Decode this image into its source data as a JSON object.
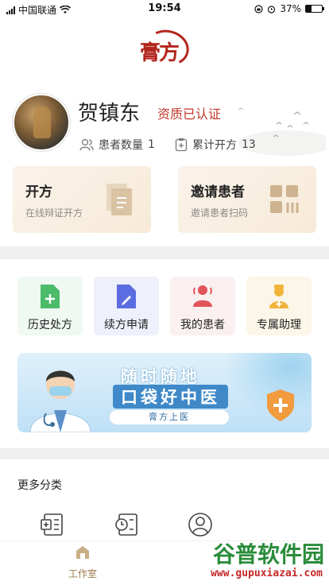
{
  "status_bar": {
    "carrier": "中国联通",
    "time": "19:54",
    "battery": "37%",
    "battery_level": 0.37,
    "icons": [
      "signal-icon",
      "wifi-icon",
      "lock-rotation-icon",
      "alarm-icon",
      "battery-icon"
    ]
  },
  "brand": {
    "logo_text": "膏方",
    "color": "#b3261e"
  },
  "profile": {
    "name": "贺镇东",
    "certification": "资质已认证",
    "patients_label": "患者数量",
    "patients_value": "1",
    "rx_label": "累计开方",
    "rx_value": "13"
  },
  "cards": {
    "prescribe": {
      "title": "开方",
      "subtitle": "在线辩证开方",
      "icon": "document-icon"
    },
    "invite": {
      "title": "邀请患者",
      "subtitle": "邀请患者扫码",
      "icon": "qr-code-icon"
    }
  },
  "quick_actions": [
    {
      "label": "历史处方",
      "icon": "history-prescription-icon",
      "color": "#4cbb6a"
    },
    {
      "label": "续方申请",
      "icon": "renew-prescription-icon",
      "color": "#5b6de0"
    },
    {
      "label": "我的患者",
      "icon": "my-patients-icon",
      "color": "#e0545a"
    },
    {
      "label": "专属助理",
      "icon": "assistant-icon",
      "color": "#f0b43a"
    }
  ],
  "banner": {
    "line1": "随时随地",
    "line2": "口袋好中医",
    "tagline": "膏方上医"
  },
  "more_section": {
    "title": "更多分类",
    "items": [
      {
        "icon": "prescription-list-icon"
      },
      {
        "icon": "clock-record-icon"
      },
      {
        "icon": "user-circle-icon"
      }
    ]
  },
  "tabbar": {
    "home_label": "工作室",
    "accent": "#9b7b4e"
  },
  "watermark": {
    "main": "谷普软件园",
    "sub": "www.gupuxiazai.com"
  }
}
